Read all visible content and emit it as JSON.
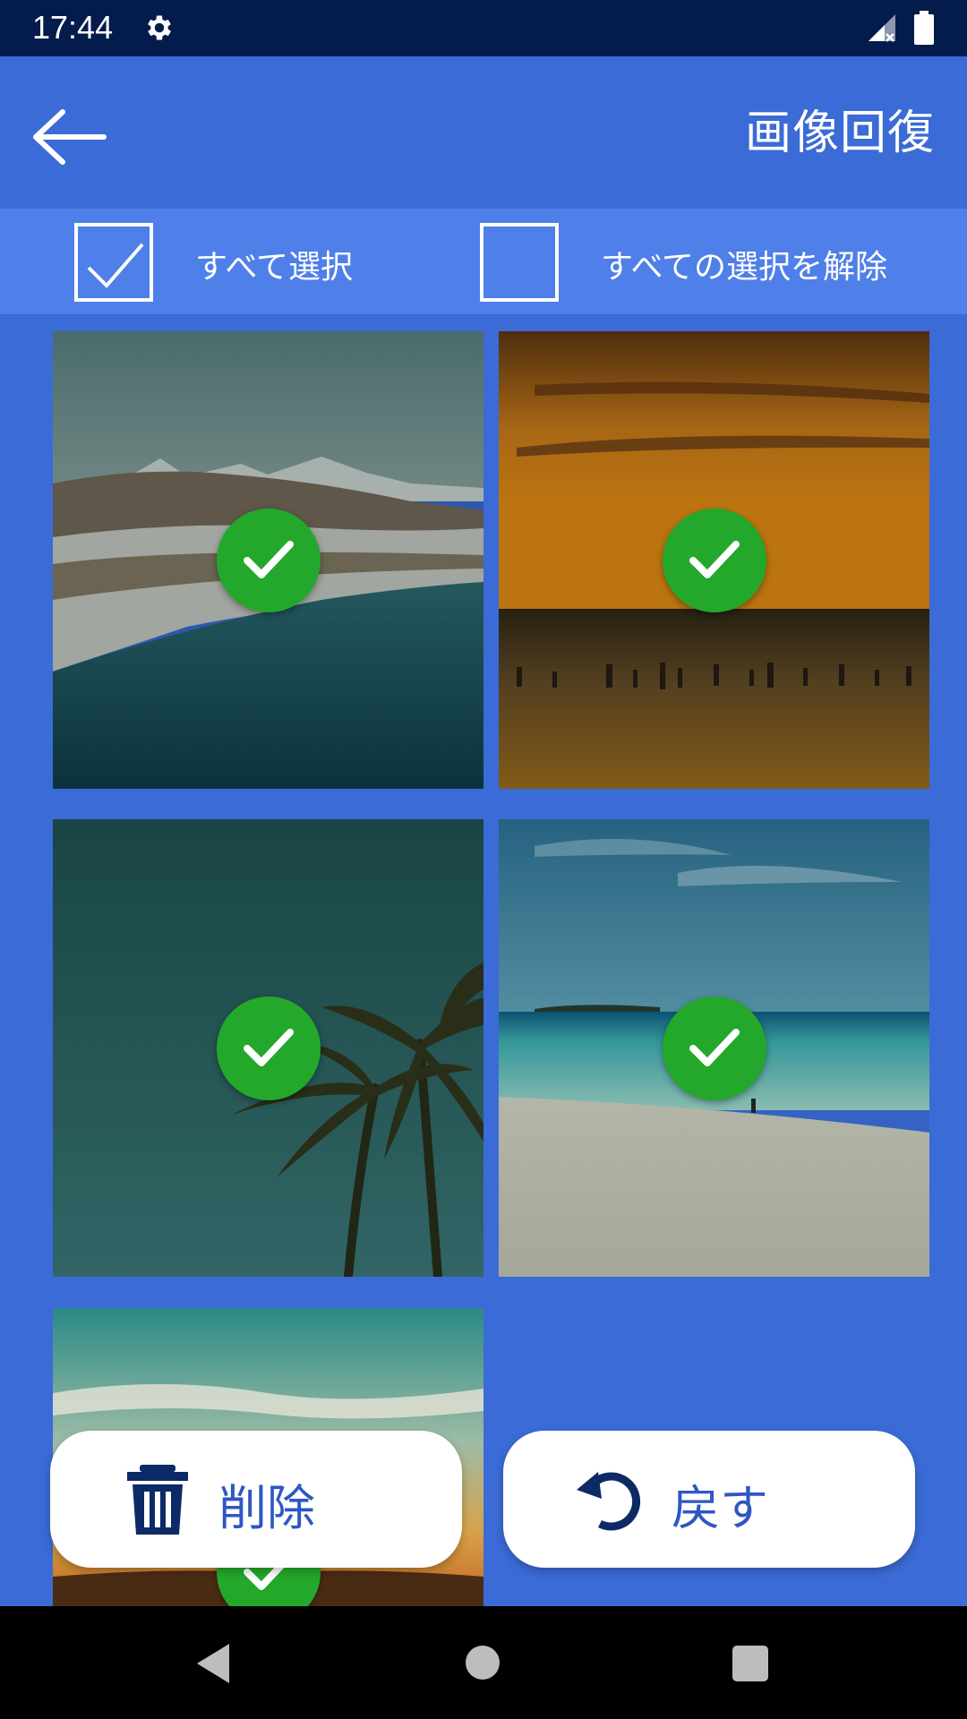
{
  "status_bar": {
    "time": "17:44",
    "icons": [
      "gear-icon",
      "signal-icon",
      "battery-icon"
    ]
  },
  "app_bar": {
    "title": "画像回復",
    "back_icon": "arrow-left-icon"
  },
  "selection": {
    "select_all_label": "すべて選択",
    "select_all_checked": true,
    "deselect_all_label": "すべての選択を解除",
    "deselect_all_checked": false
  },
  "images": [
    {
      "subject": "snowy-coastline",
      "selected": true
    },
    {
      "subject": "sunset-beach",
      "selected": true
    },
    {
      "subject": "palm-trees",
      "selected": true
    },
    {
      "subject": "white-sand-beach",
      "selected": true
    },
    {
      "subject": "sunset-sky",
      "selected": true
    }
  ],
  "actions": {
    "delete_label": "削除",
    "delete_icon": "trash-icon",
    "restore_label": "戻す",
    "restore_icon": "undo-icon"
  },
  "nav_bar": {
    "icons": [
      "nav-back-icon",
      "nav-home-icon",
      "nav-recents-icon"
    ]
  },
  "colors": {
    "status_bar": "#031c4c",
    "app_bar": "#3b6bd6",
    "select_bar": "#4f7fe8",
    "check_green": "#23a82b",
    "button_text": "#2e57c4",
    "button_icon": "#0c2a66"
  }
}
